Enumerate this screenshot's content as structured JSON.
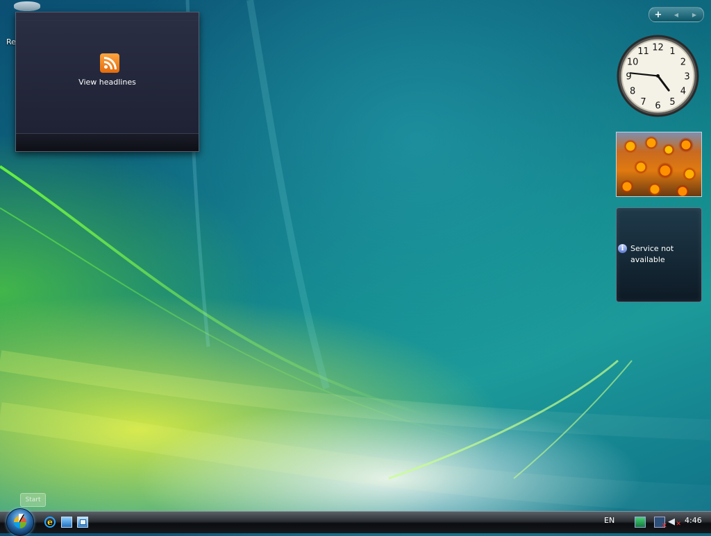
{
  "desktop": {
    "recycle_bin_label": "Re"
  },
  "feed_gadget": {
    "icon": "rss-icon",
    "link_label": "View headlines"
  },
  "sidebar": {
    "add_label": "+",
    "prev_label": "◀",
    "next_label": "▶"
  },
  "clock": {
    "numerals": [
      "12",
      "1",
      "2",
      "3",
      "4",
      "5",
      "6",
      "7",
      "8",
      "9",
      "10",
      "11"
    ],
    "hour": 4,
    "minute": 46
  },
  "weather": {
    "icon": "info-icon",
    "info_glyph": "i",
    "message": "Service not available"
  },
  "start_tooltip": {
    "label": "Start"
  },
  "taskbar": {
    "language": "EN",
    "time": "4:46",
    "quick_launch": [
      "internet-explorer-icon",
      "show-desktop-icon",
      "switch-windows-icon"
    ],
    "tray_icons": [
      "network-icon",
      "network-disconnected-icon",
      "volume-muted-icon"
    ]
  }
}
